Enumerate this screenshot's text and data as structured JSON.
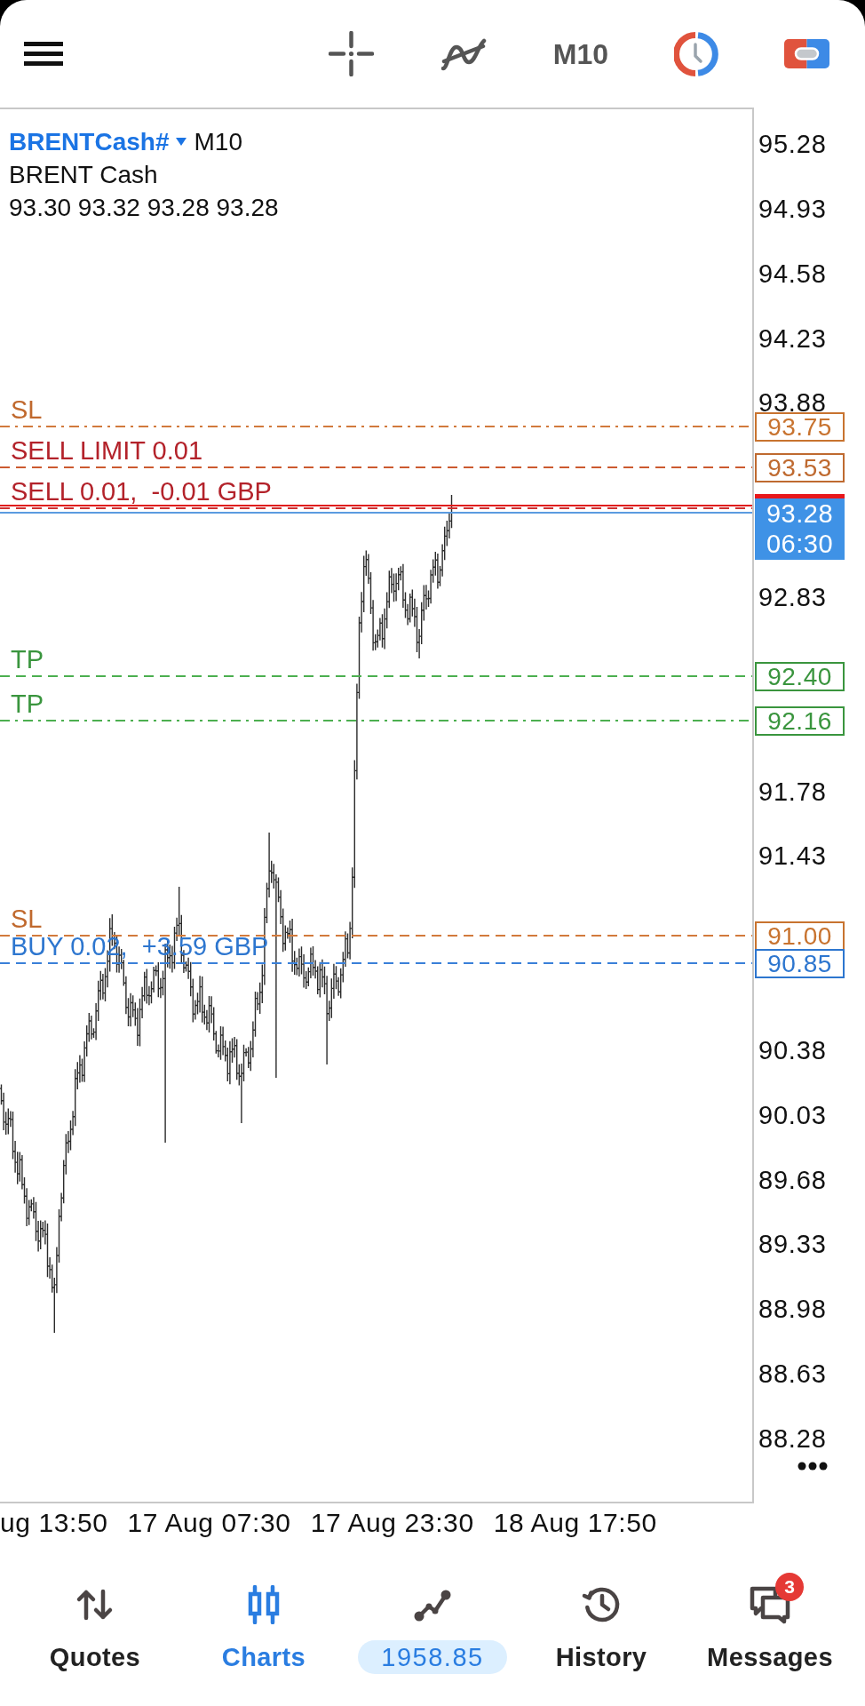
{
  "top_bar": {
    "timeframe": "M10"
  },
  "chart": {
    "symbol": "BRENTCash#",
    "timeframe": "M10",
    "description": "BRENT Cash",
    "ohlc": "93.30 93.32 93.28 93.28",
    "price_axis": [
      "95.28",
      "94.93",
      "94.58",
      "94.23",
      "93.88",
      "92.83",
      "91.78",
      "91.43",
      "90.38",
      "90.03",
      "89.68",
      "89.33",
      "88.98",
      "88.63",
      "88.28"
    ],
    "levels": [
      {
        "kind": "sl",
        "label": "SL",
        "price": "93.75",
        "dash_dot": true
      },
      {
        "kind": "sell_limit",
        "label": "SELL LIMIT 0.01",
        "price": "93.53",
        "dash_dot": false
      },
      {
        "kind": "sell",
        "label": "SELL 0.01,  -0.01 GBP",
        "dash_dot": false
      },
      {
        "kind": "tp",
        "label": "TP",
        "price": "92.40",
        "dash_dot": false
      },
      {
        "kind": "tp",
        "label": "TP",
        "price": "92.16",
        "dash_dot": true
      },
      {
        "kind": "sl",
        "label": "SL",
        "price": "91.00",
        "dash_dot": false
      },
      {
        "kind": "buy",
        "label": "BUY 0.02,  +3.59 GBP",
        "price": "90.85",
        "dash_dot": false
      }
    ],
    "current_price": {
      "price": "93.28",
      "countdown": "06:30"
    },
    "time_axis": [
      "ug 13:50",
      "17 Aug 07:30",
      "17 Aug 23:30",
      "18 Aug 17:50"
    ]
  },
  "bottom_nav": [
    {
      "kind": "quotes",
      "label": "Quotes",
      "selected": false
    },
    {
      "kind": "charts",
      "label": "Charts",
      "selected": true
    },
    {
      "kind": "balance",
      "label": "1958.85",
      "selected": false
    },
    {
      "kind": "history",
      "label": "History",
      "selected": false
    },
    {
      "kind": "messages",
      "label": "Messages",
      "selected": false,
      "badge": "3"
    }
  ]
}
